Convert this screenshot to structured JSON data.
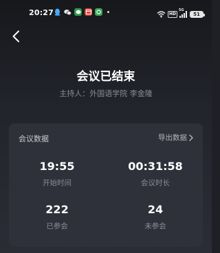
{
  "status_bar": {
    "time": "20:27",
    "apps": [
      {
        "icon": "qq-penguin-icon",
        "glyph": "◆",
        "color": "#4aa8ff",
        "bg": "transparent"
      },
      {
        "icon": "wechat-icon",
        "glyph": "●",
        "color": "#ffffff",
        "bg": "transparent"
      },
      {
        "icon": "wechat-work-icon",
        "glyph": "W",
        "color": "#ffffff",
        "bg": "#2a9d4b"
      },
      {
        "icon": "calendar-app-icon",
        "glyph": "31",
        "color": "#ffffff",
        "bg": "#d8413a"
      },
      {
        "icon": "green-app-icon",
        "glyph": "●",
        "color": "#ffffff",
        "bg": "#3aa657"
      }
    ],
    "network_badge": "HD",
    "signal_label": "5G",
    "battery": "51"
  },
  "header": {
    "title": "会议已结束",
    "host_prefix": "主持人：",
    "host_name": "外国语学院 李金隆"
  },
  "card": {
    "title": "会议数据",
    "export_label": "导出数据",
    "stats": [
      {
        "value": "19:55",
        "label": "开始时间"
      },
      {
        "value": "00:31:58",
        "label": "会议时长"
      },
      {
        "value": "222",
        "label": "已参会"
      },
      {
        "value": "24",
        "label": "未参会"
      }
    ]
  },
  "colors": {
    "background": "#1e2026",
    "card": "#2e3139",
    "text_primary": "#ffffff",
    "text_secondary": "#8a8d94"
  }
}
